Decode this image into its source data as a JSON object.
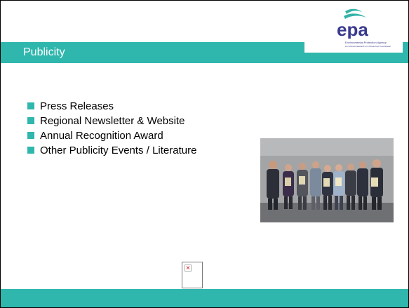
{
  "slide": {
    "title": "Publicity",
    "bullets": [
      "Press Releases",
      "Regional Newsletter & Website",
      "Annual Recognition Award",
      "Other Publicity Events / Literature"
    ]
  },
  "logo": {
    "wordmark": "epa",
    "tagline": "Environmental Protection Agency",
    "tagline_irish": "An Ghníomhaireacht um Chaomhnú Comhshaoil"
  },
  "colors": {
    "accent": "#2fb7ad",
    "logo_blue": "#3a3a8f",
    "logo_teal": "#35b3a8"
  },
  "icons": {
    "bullet": "square-bullet-icon",
    "broken_image": "broken-image-icon"
  }
}
